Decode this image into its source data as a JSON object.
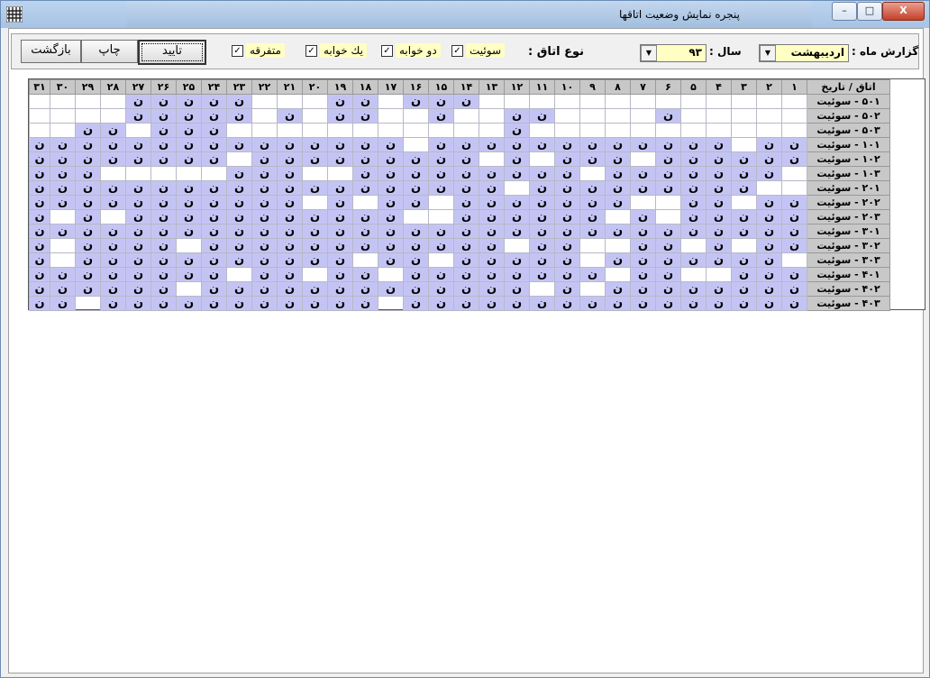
{
  "window": {
    "title": "پنجره نمایش وضعیت اتاقها",
    "min_label": "–",
    "max_label": "□",
    "close_label": "X"
  },
  "toolbar": {
    "month_report_label": "گزارش ماه :",
    "month_value": "اردیبهشت",
    "year_label": "سال :",
    "year_value": "۹۳",
    "room_type_label": "نوع اتاق :",
    "types": [
      {
        "label": "سوئیت",
        "checked": true
      },
      {
        "label": "دو خوابه",
        "checked": true
      },
      {
        "label": "یك خوابه",
        "checked": true
      },
      {
        "label": "متفرقه",
        "checked": true
      }
    ],
    "confirm_label": "تایید",
    "print_label": "چاپ",
    "back_label": "بازگشت"
  },
  "grid": {
    "corner_header": "اتاق / تاریخ",
    "mark": "ن",
    "days": [
      "۱",
      "۲",
      "۳",
      "۴",
      "۵",
      "۶",
      "۷",
      "۸",
      "۹",
      "۱۰",
      "۱۱",
      "۱۲",
      "۱۳",
      "۱۴",
      "۱۵",
      "۱۶",
      "۱۷",
      "۱۸",
      "۱۹",
      "۲۰",
      "۲۱",
      "۲۲",
      "۲۳",
      "۲۴",
      "۲۵",
      "۲۶",
      "۲۷",
      "۲۸",
      "۲۹",
      "۳۰",
      "۳۱"
    ],
    "rows": [
      {
        "room": "۵۰۱ - سوئیت",
        "occ": "0000000000000111011000111110000100"
      },
      {
        "room": "۵۰۲ - سوئیت",
        "occ": "0000010000110010011010111110000000"
      },
      {
        "room": "۵۰۳ - سوئیت",
        "occ": "0000000000010000000000011101100000"
      },
      {
        "room": "۱۰۱ - سوئیت",
        "occ": "1101111111111110111111111111111111"
      },
      {
        "room": "۱۰۲ - سوئیت",
        "occ": "1111110111010111111111011111111111"
      },
      {
        "room": "۱۰۳ - سوئیت",
        "occ": "0111111101111111110011100000111111"
      },
      {
        "room": "۲۰۱ - سوئیت",
        "occ": "0011111111101111111111111111111111"
      },
      {
        "room": "۲۰۲ - سوئیت",
        "occ": "1101100111111101101011111111111111"
      },
      {
        "room": "۲۰۳ - سوئیت",
        "occ": "1111101011111100111111111110101111"
      },
      {
        "room": "۳۰۱ - سوئیت",
        "occ": "1111111111111111111111111111111111"
      },
      {
        "room": "۳۰۲ - سوئیت",
        "occ": "1101011001101111111111110111101111"
      },
      {
        "room": "۳۰۳ - سوئیت",
        "occ": "0111111101111101101111111111101111"
      },
      {
        "room": "۴۰۱ - سوئیت",
        "occ": "1110011011111111011011011111111111"
      },
      {
        "room": "۴۰۲ - سوئیت",
        "occ": "1111111101011111111111110111111111"
      },
      {
        "room": "۴۰۳ - سوئیت",
        "occ": "1111111111111111011111111111011111"
      }
    ]
  }
}
